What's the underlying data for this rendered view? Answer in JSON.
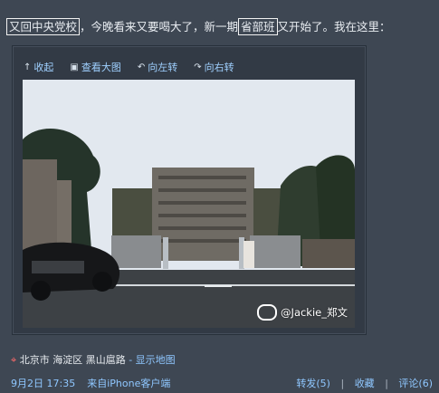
{
  "post": {
    "highlight1": "又回中央党校",
    "text1": "，今晚看来又要喝大了，新一期",
    "highlight2": "省部班",
    "text2": "又开始了。我在这里："
  },
  "media": {
    "toolbar": {
      "collapse": "收起",
      "view_large": "查看大图",
      "rotate_left": "向左转",
      "rotate_right": "向右转"
    },
    "watermark": "@Jackie_郑文"
  },
  "location": {
    "place": "北京市 海淀区 黑山扈路",
    "map_link": "- 显示地图"
  },
  "footer": {
    "date": "9月2日",
    "time": "17:35",
    "source": "来自iPhone客户端",
    "repost": "转发(5)",
    "favorite": "收藏",
    "comment": "评论(6)",
    "sep": "|"
  }
}
